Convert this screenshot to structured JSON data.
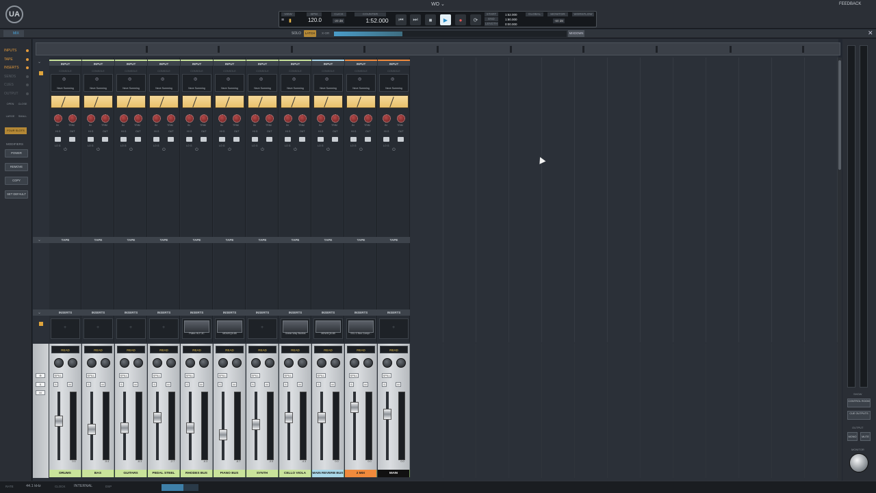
{
  "window": {
    "title": "WO ⌄",
    "feedback": "FEEDBACK"
  },
  "transport": {
    "view": "VIEW",
    "bpm_label": "BPM",
    "bpm": "120.0",
    "click_label": "CLICK",
    "click_level": "-20 dB",
    "counter_label": "COUNTER",
    "counter": "1:52.000",
    "start_label": "START",
    "end_label": "END",
    "length_label": "LENGTH",
    "start": "1:52.000",
    "end": "1:80.000",
    "length": "0:00.000",
    "global_label": "GLOBAL",
    "monitor_label": "MONITOR",
    "monitor_level": "-60 dB",
    "workflow_label": "WORKFLOW"
  },
  "toolbar": {
    "mix_tab": "MIX",
    "solo": "SOLO",
    "latch": "LATCH",
    "xor": "X-OR",
    "mixdown": "MIXDOWN"
  },
  "sidebar": {
    "items": [
      {
        "label": "INPUTS",
        "on": true
      },
      {
        "label": "TAPE",
        "on": true
      },
      {
        "label": "INSERTS",
        "on": true
      },
      {
        "label": "SENDS",
        "on": false
      },
      {
        "label": "CUES",
        "on": false
      },
      {
        "label": "OUTPUT",
        "on": false
      }
    ],
    "open": "OPEN",
    "close": "CLOSE",
    "large": "LARGE",
    "small": "SMALL",
    "four_slots": "FOUR SLOTS",
    "modifiers": "MODIFIERS",
    "mod_buttons": [
      "POWER",
      "REMOVE",
      "COPY",
      "SET DEFAULT"
    ]
  },
  "sections": {
    "input": "INPUT",
    "tape": "TAPE",
    "inserts": "INSERTS",
    "console": "CONSOLE",
    "console_plugin": "Neve Summing",
    "hi_g": "HI G",
    "out": "OUT",
    "in": "IN",
    "trim": "TRIM",
    "lo_g": "LO G"
  },
  "channels": [
    {
      "name": "DRUMS",
      "color": "#c9e39b",
      "read": "READ",
      "value": "0.0",
      "insert": ""
    },
    {
      "name": "BAS",
      "color": "#c9e39b",
      "read": "READ",
      "value": "-5.4",
      "insert": ""
    },
    {
      "name": "GUITARS",
      "color": "#c9e39b",
      "read": "READ",
      "value": "-6.3",
      "insert": ""
    },
    {
      "name": "PEDAL STEEL",
      "color": "#c9e39b",
      "read": "READ",
      "value": "-2.7",
      "insert": ""
    },
    {
      "name": "RHODES BUS",
      "color": "#c9e39b",
      "read": "READ",
      "value": "-6.3",
      "insert": "Pultec HLF-3C"
    },
    {
      "name": "PIANO BUS",
      "color": "#c9e39b",
      "read": "READ",
      "value": "-8.7",
      "insert": "MDWEQ5-6B"
    },
    {
      "name": "SYNTH",
      "color": "#c9e39b",
      "read": "READ",
      "value": "-3.5",
      "insert": ""
    },
    {
      "name": "CELLO VIOLA",
      "color": "#c9e39b",
      "read": "READ",
      "value": "-4.3",
      "insert": "Ocean Way Studios"
    },
    {
      "name": "MAIN REVERB BUS",
      "color": "#a9d7e8",
      "read": "READ",
      "value": "0.0",
      "insert": "MDWEQ5-6B"
    },
    {
      "name": "2 MIX",
      "color": "#f08a3c",
      "read": "READ",
      "value": "0.0",
      "insert": "SSL G Bus Compr..."
    },
    {
      "name": "MAIN",
      "color": "#111111",
      "read": "READ",
      "value": "0.0",
      "insert": ""
    }
  ],
  "right_panel": {
    "show": "SHOW",
    "control_room": "CONTROL ROOM",
    "cue_outputs": "CUE OUTPUTS",
    "output": "OUTPUT",
    "mono": "MONO",
    "mute": "MUTE",
    "monitor": "MONITOR"
  },
  "status": {
    "rate_label": "RATE",
    "rate": "44.1 kHz",
    "clock_label": "CLOCK",
    "clock": "INTERNAL",
    "dsp_label": "DSP"
  }
}
